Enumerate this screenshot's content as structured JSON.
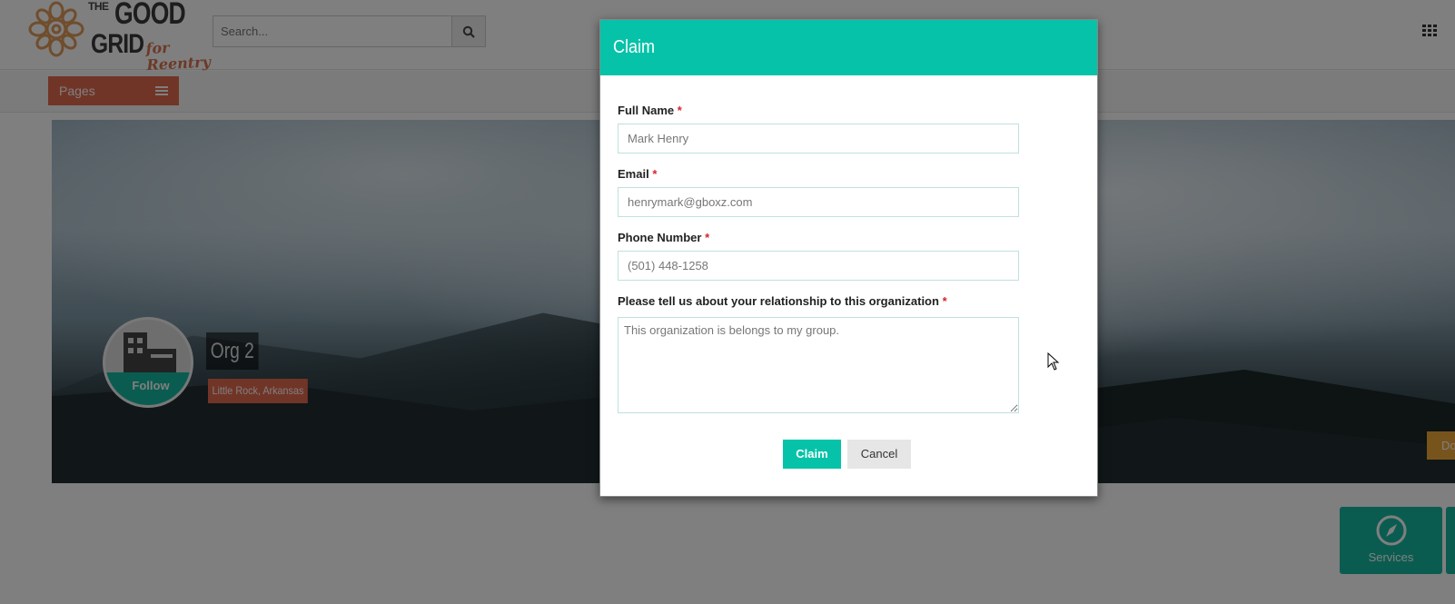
{
  "header": {
    "logo_the": "THE",
    "logo_good": "GOOD",
    "logo_grid": "GRID",
    "logo_tagline": "for Reentry",
    "search_placeholder": "Search...",
    "search_icon": "magnifier-icon",
    "apps_icon": "grid-icon"
  },
  "subnav": {
    "pages_label": "Pages"
  },
  "profile": {
    "org_name": "Org 2",
    "location": "Little Rock, Arkansas",
    "follow_label": "Follow",
    "donate_label": "Do",
    "services_label": "Services"
  },
  "modal": {
    "title": "Claim",
    "required_mark": "*",
    "fields": [
      {
        "label": "Full Name",
        "placeholder": "Mark Henry"
      },
      {
        "label": "Email",
        "placeholder": "henrymark@gboxz.com"
      },
      {
        "label": "Phone Number",
        "placeholder": "(501) 448-1258"
      }
    ],
    "relationship": {
      "label": "Please tell us about your relationship to this organization",
      "placeholder": "This organization is belongs to my group."
    },
    "claim_button": "Claim",
    "cancel_button": "Cancel"
  },
  "colors": {
    "accent_teal": "#06c2a8",
    "brand_orange": "#e26a4e",
    "donate_yellow": "#f0a83a",
    "required_red": "#d9232d"
  }
}
